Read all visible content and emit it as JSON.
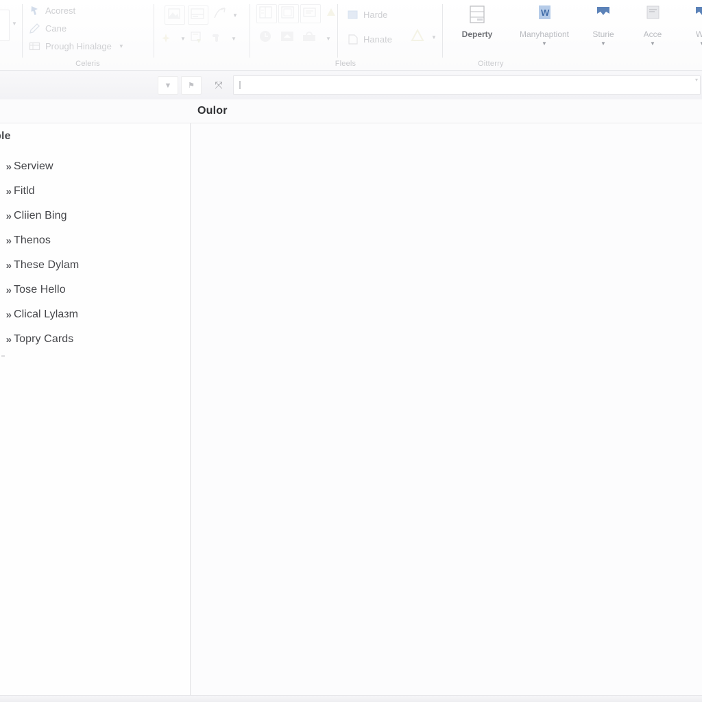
{
  "ribbon": {
    "groups": [
      {
        "name": "celeris",
        "label": "Celeris",
        "items": [
          {
            "label": "Acorest",
            "icon": "pointer-icon",
            "has_caret": false
          },
          {
            "label": "Cane",
            "icon": "pen-icon",
            "has_caret": false
          },
          {
            "label": "Prough Hinalage",
            "icon": "grid-icon",
            "has_caret": true
          }
        ]
      },
      {
        "name": "unlabeled-tools",
        "label": "",
        "items": [
          {
            "label": "",
            "icon": "image-frame-icon",
            "has_caret": false
          },
          {
            "label": "",
            "icon": "window-split-icon",
            "has_caret": false
          },
          {
            "label": "",
            "icon": "arrow-curve-icon",
            "has_caret": true
          },
          {
            "label": "",
            "icon": "sparkle-icon",
            "has_caret": true
          },
          {
            "label": "",
            "icon": "card-add-icon",
            "has_caret": false
          },
          {
            "label": "",
            "icon": "puzzle-icon",
            "has_caret": true
          }
        ]
      },
      {
        "name": "fleels",
        "label": "Fleels",
        "items": [
          {
            "label": "",
            "icon": "layout-split-icon",
            "has_caret": false
          },
          {
            "label": "",
            "icon": "layout-panel-icon",
            "has_caret": false
          },
          {
            "label": "",
            "icon": "list-icon",
            "has_caret": false
          },
          {
            "label": "",
            "icon": "warning-triangle-icon",
            "has_caret": false
          },
          {
            "label": "",
            "icon": "clock-icon",
            "has_caret": false
          },
          {
            "label": "",
            "icon": "inbox-icon",
            "has_caret": false
          },
          {
            "label": "",
            "icon": "briefcase-icon",
            "has_caret": true
          },
          {
            "label": "Harde",
            "icon": "blue-square-icon",
            "has_caret": false
          },
          {
            "label": "Hanate",
            "icon": "note-corner-icon",
            "has_caret": false
          },
          {
            "label": "",
            "icon": "warning-triangle-icon",
            "has_caret": true
          }
        ]
      },
      {
        "name": "oitterry",
        "label": "Oitterry",
        "items": [
          {
            "label": "Deperty",
            "icon": "table-rows-icon",
            "has_caret": false
          },
          {
            "label": "Manyhaptiont",
            "icon": "blue-doc-icon",
            "has_caret": true
          },
          {
            "label": "Sturie",
            "icon": "blue-flag-icon",
            "has_caret": true
          },
          {
            "label": "Acce",
            "icon": "gray-page-icon",
            "has_caret": true
          },
          {
            "label": "Wh",
            "icon": "blue-flag-icon",
            "has_caret": true
          }
        ]
      }
    ]
  },
  "toolbar": {
    "buttons": [
      {
        "name": "dropdown-button",
        "glyph": "▼"
      },
      {
        "name": "filter-button",
        "glyph": "⚑"
      },
      {
        "name": "link-button",
        "glyph": "⤧"
      }
    ],
    "field": {
      "value": "",
      "placeholder": ""
    },
    "field_caret": "▾"
  },
  "header": {
    "column_label": "Oulor"
  },
  "sidebar": {
    "title": "ble",
    "chevron": "»",
    "items": [
      {
        "label": "Serview"
      },
      {
        "label": "Fitld"
      },
      {
        "label": "Cliien Bing"
      },
      {
        "label": "Thenos"
      },
      {
        "label": "These Dylam"
      },
      {
        "label": "Tose Hello"
      },
      {
        "label": "Clical Lylазm"
      },
      {
        "label": "Topry Cards"
      }
    ]
  },
  "colors": {
    "accent_blue": "#4a7ebb",
    "ribbon_bg": "#fbfbfc",
    "content_bg": "#fcfcfd",
    "text": "#46474b",
    "faded_text": "#cfd0d3"
  }
}
